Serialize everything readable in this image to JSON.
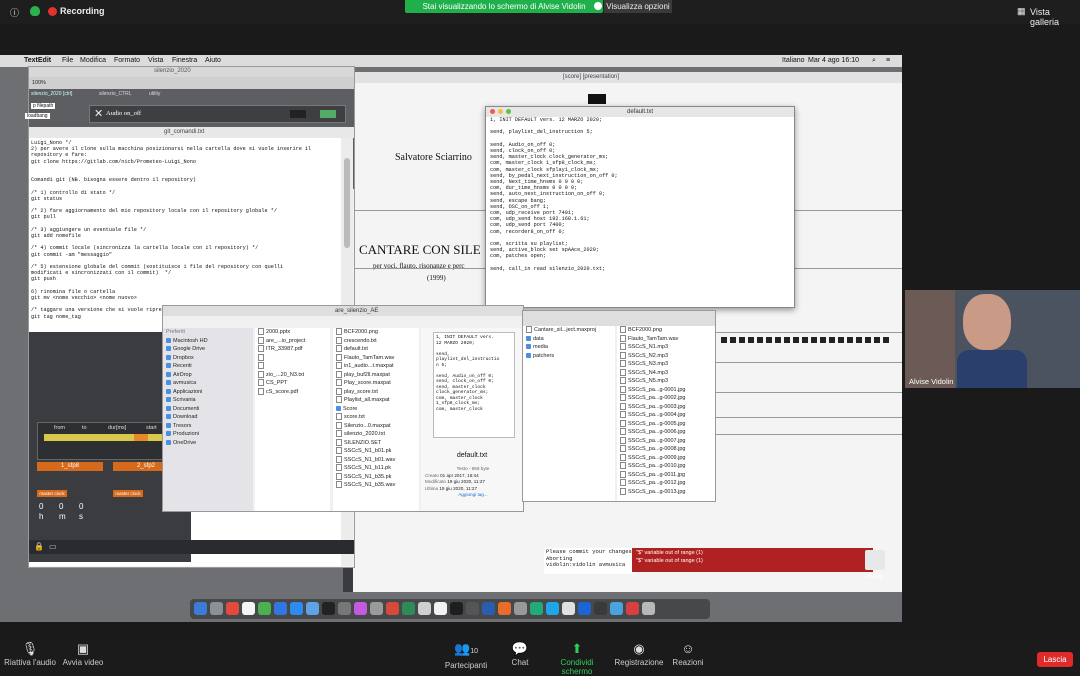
{
  "zoom_top": {
    "recording": "Recording",
    "share_banner": "Stai visualizzando lo schermo di Alvise Vidolin",
    "view_options": "Visualizza opzioni",
    "gallery": "Vista galleria"
  },
  "menubar": {
    "app": "TextEdit",
    "items": [
      "File",
      "Modifica",
      "Formato",
      "Vista",
      "Finestra",
      "Aiuto"
    ],
    "language": "Italiano",
    "clock": "Mar 4 ago  16:10"
  },
  "textedit": {
    "title": "git_comandi.txt",
    "max_title": "silenzio_2020",
    "zoom": "100%",
    "tabs": [
      "silenzio_2020 [ctrl]",
      "silenzio_CTRL",
      "utility"
    ],
    "filepath_btn": "p filepath",
    "loadbang": "loadbang",
    "audio_label": "Audio on_off",
    "body": "Luigi_Nono */\n2) per avere il clone sulla macchina posizionarsi nella cartella dove si vuole inserire il\nrepository e fare:\ngit clone https://gitlab.com/nicb/Prometeo-Luigi_Nono\n\n\nComandi git (NB. bisogna essere dentro il repository)\n\n/* 1) controllo di stato */\ngit status\n\n/* 2) fare aggiornamento del mio repository locale con il repository globale */\ngit pull\n\n/* 3) aggiungere un eventuale file */\ngit add nomefile\n\n/* 4) commit locale (sincronizza la cartella locale con il repository) */\ngit commit -am \"messaggio\"\n\n/* 5) estensione globale del commit (sostituisce i file del repository con quelli\nmodificati e sincronizzati con il commit)  */\ngit push\n\n6) rinomina file o cartella\ngit mv <nome vecchio> <nome nuovo>\n\n/* taggare una versione che si vuole riprendere */\ngit tag nome_tag"
  },
  "score": {
    "composer": "Salvatore Sciarrino",
    "title": "CANTARE CON SILE",
    "subtitle": "per voci, flauto, risonanze e perc",
    "year": "(1999)",
    "window_title": "[score]  [presentation]"
  },
  "default_txt": {
    "title": "default.txt",
    "body": "1, INIT DEFAULT vers. 12 MARZO 2020;\n\nsend, playlist_del_instruction 5;\n\nsend, Audio_on_off 0;\nsend, clock_on_off 0;\nsend, master_clock clock_generator_ms;\ncom, master_clock 1_sfp8_clock_ms;\ncom, master_clock sfplay1_clock_ms;\nsend, by_pedal_next_instruction_on_off 0;\nsend, Next_time_hnsms 0 0 0 0;\ncom, dur_time_hnsms 0 0 0 0;\nsend, auto_next_instruction_on_off 0;\nsend, escape bang;\nsend, OSC_on_off 1;\ncom, udp_receive port 7401;\ncom, udp_send host 192.168.1.61;\ncom, udp_send port 7400;\ncom, recorder8_on_off 0;\n\ncom, scritta su playlist;\nsend, active_block set spAAce_2020;\ncom, patches open;\n\nsend, call_in read silenzio_2020.txt;"
  },
  "finder1": {
    "title": "are_silenzio_AE",
    "sidebar_header": "Preferiti",
    "sidebar": [
      "Macintosh HD",
      "Google Drive",
      "Dropbox",
      "Recenti",
      "AirDrop",
      "avmusica",
      "Applicazioni",
      "Scrivania",
      "Documenti",
      "Download",
      "Tresors",
      "Produzioni",
      "OneDrive"
    ],
    "col1": [
      "2000.pptx",
      "are_...io_project",
      "ITR_33987.pdf",
      "",
      "",
      "zio_...20_N3.txt",
      "CS_PPT",
      "cS_score.pdf"
    ],
    "col2": [
      "BCF2000.png",
      "crescendo.txt",
      "default.txt",
      "Flauto_TamTam.wav",
      "in1_audio...t.maxpat",
      "play_buf2ll.maxpat",
      "Play_score.maxpat",
      "play_score.txt",
      "Playlist_all.maxpat",
      "Score",
      "score.txt",
      "Silenzio...0.maxpat",
      "silenzio_2020.txt",
      "SILENZIO.SET",
      "SSCcS_N1_b01.pk",
      "SSCcS_N1_b01.wav",
      "SSCcS_N1_b11.pk",
      "SSCcS_N1_b35.pk",
      "SSCcS_N1_b35.wav"
    ],
    "preview_name": "default.txt",
    "preview_meta": [
      [
        "Testo - 659 byte",
        ""
      ],
      [
        "Creato",
        "01 apr 2017, 16:44"
      ],
      [
        "Modificato",
        "19 giu 2020, 11:27"
      ],
      [
        "Ultima",
        "19 giu 2020, 11:27"
      ]
    ],
    "add_tags": "Aggiungi tag...",
    "preview_text": "1, INIT DEFAULT vers.\n12 MARZO 2020;\n\nsend,\nplaylist_del_instructio\nn 5;\n\nsend, Audio_on_off 0;\nsend, clock_on_off 0;\nsend, master_clock\nclock_generator_ms;\ncom, master_clock\n1_sfp8_clock_ms;\ncom, master_clock"
  },
  "finder2": {
    "col1": [
      "Cantare_sil...ject.maxproj",
      "data",
      "media",
      "patchers"
    ],
    "col2": [
      "BCF2000.png",
      "Flauto_TamTam.wav",
      "SSCcS_N1.mp3",
      "SSCcS_N2.mp3",
      "SSCcS_N3.mp3",
      "SSCcS_N4.mp3",
      "SSCcS_N5.mp3",
      "SSCcS_pa...g-0001.jpg",
      "SSCcS_pa...g-0002.jpg",
      "SSCcS_pa...g-0003.jpg",
      "SSCcS_pa...g-0004.jpg",
      "SSCcS_pa...g-0005.jpg",
      "SSCcS_pa...g-0006.jpg",
      "SSCcS_pa...g-0007.jpg",
      "SSCcS_pa...g-0008.jpg",
      "SSCcS_pa...g-0009.jpg",
      "SSCcS_pa...g-0010.jpg",
      "SSCcS_pa...g-0011.jpg",
      "SSCcS_pa...g-0012.jpg",
      "SSCcS_pa...g-0013.jpg"
    ]
  },
  "patcher": {
    "from": "from",
    "to": "to",
    "dur": "dur[ms]",
    "start": "start",
    "sfp1": "1_sfp8",
    "sfp2": "2_sfp2",
    "master_clock": "master clock",
    "hms": [
      "h",
      "m",
      "s"
    ],
    "zero_vals": [
      "0",
      "0",
      "0"
    ]
  },
  "console": {
    "text": "Please commit your changes\nAborting\nvidolin:vidolin avmusica",
    "errors": [
      "\"$\" variable out of range (1)",
      "\"$\" variable out of range (1)"
    ]
  },
  "desktop_file": ".P.png",
  "video": {
    "name": "Alvise Vidolin"
  },
  "bottom_bar": {
    "audio": "Riattiva l'audio",
    "video": "Avvia video",
    "participants": "Partecipanti",
    "participants_count": "10",
    "chat": "Chat",
    "share": "Condividi schermo",
    "record": "Registrazione",
    "reactions": "Reazioni",
    "leave": "Lascia"
  },
  "colors": {
    "share_green": "#1fb04b",
    "leave_red": "#e02b2b",
    "max_orange": "#d66a1c"
  }
}
